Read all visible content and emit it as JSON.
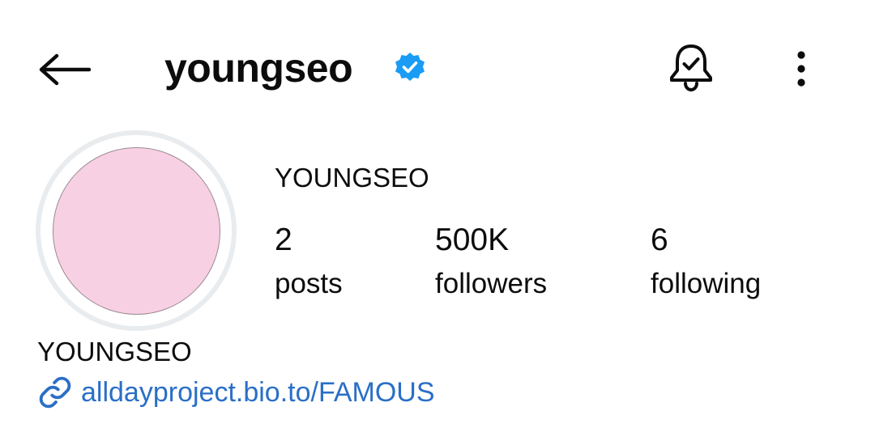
{
  "header": {
    "username": "youngseo",
    "back_icon": "arrow-left-icon",
    "verified_icon": "verified-badge-icon",
    "bell_icon": "bell-check-icon",
    "more_icon": "more-vertical-icon"
  },
  "profile": {
    "display_name": "YOUNGSEO",
    "avatar_color": "#f8d0e4",
    "stats": {
      "posts": {
        "value": "2",
        "label": "posts"
      },
      "followers": {
        "value": "500K",
        "label": "followers"
      },
      "following": {
        "value": "6",
        "label": "following"
      }
    }
  },
  "bio": {
    "name": "YOUNGSEO",
    "link_icon": "link-icon",
    "link_text": "alldayproject.bio.to/FAMOUS"
  },
  "colors": {
    "text": "#0c0c0c",
    "verified_blue": "#1a9cf5",
    "link_blue": "#2a6fc6",
    "avatar_ring": "#e9ecef"
  }
}
